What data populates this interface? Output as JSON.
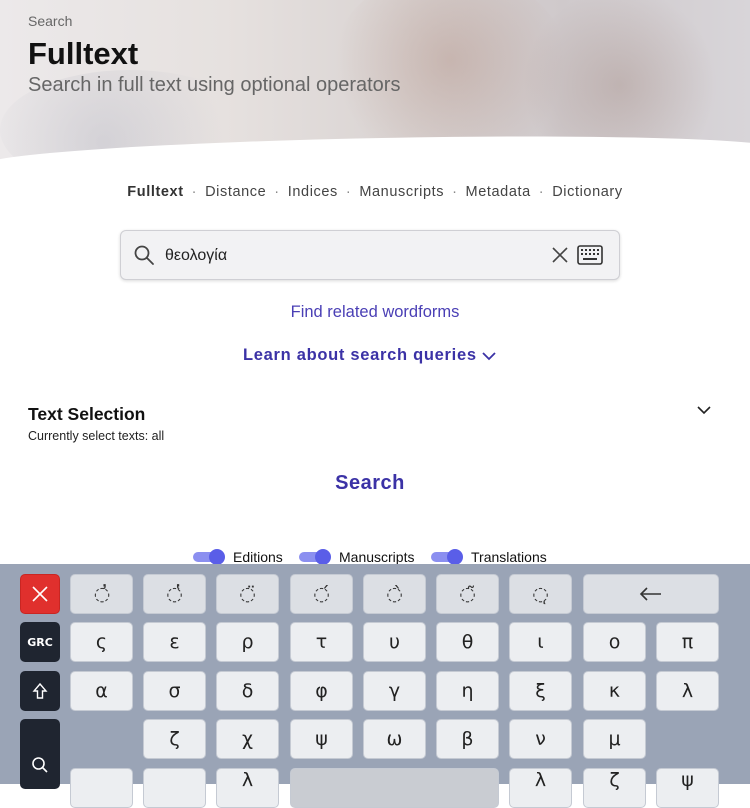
{
  "header": {
    "breadcrumb": "Search",
    "title": "Fulltext",
    "subtitle": "Search in full text using optional operators"
  },
  "tabs": [
    {
      "label": "Fulltext",
      "active": true
    },
    {
      "label": "Distance",
      "active": false
    },
    {
      "label": "Indices",
      "active": false
    },
    {
      "label": "Manuscripts",
      "active": false
    },
    {
      "label": "Metadata",
      "active": false
    },
    {
      "label": "Dictionary",
      "active": false
    }
  ],
  "tab_separator": "·",
  "search": {
    "value": "θεολογία",
    "icons": [
      "search-icon",
      "clear-icon",
      "keyboard-icon"
    ]
  },
  "links": {
    "related": "Find related wordforms",
    "learn": "Learn about search queries"
  },
  "text_selection": {
    "title": "Text Selection",
    "subtitle": "Currently select texts: all"
  },
  "search_button": "Search",
  "toggles": [
    {
      "label": "Editions",
      "on": true
    },
    {
      "label": "Manuscripts",
      "on": true
    },
    {
      "label": "Translations",
      "on": true
    }
  ],
  "colors": {
    "accent": "#3b32a6",
    "toggle_on": "#5a5ee8",
    "keyboard_bg": "#9aa4b6",
    "close_key": "#e0302d"
  },
  "keyboard": {
    "close_icon": "close-icon",
    "lang_label": "GRC",
    "shift_icon": "shift-icon",
    "search_icon": "search-icon",
    "row1": [
      "̓",
      "̔",
      "̈",
      "́",
      "̀",
      "͂",
      "ͅ"
    ],
    "backspace_icon": "backspace-icon",
    "row2": [
      "ς",
      "ε",
      "ρ",
      "τ",
      "υ",
      "θ",
      "ι",
      "ο",
      "π"
    ],
    "row3": [
      "α",
      "σ",
      "δ",
      "φ",
      "γ",
      "η",
      "ξ",
      "κ",
      "λ"
    ],
    "row4": [
      "ζ",
      "χ",
      "ψ",
      "ω",
      "β",
      "ν",
      "μ"
    ],
    "row5_partial": [
      "",
      "",
      "λ",
      "",
      "λ",
      "ζ",
      "ψ"
    ]
  }
}
